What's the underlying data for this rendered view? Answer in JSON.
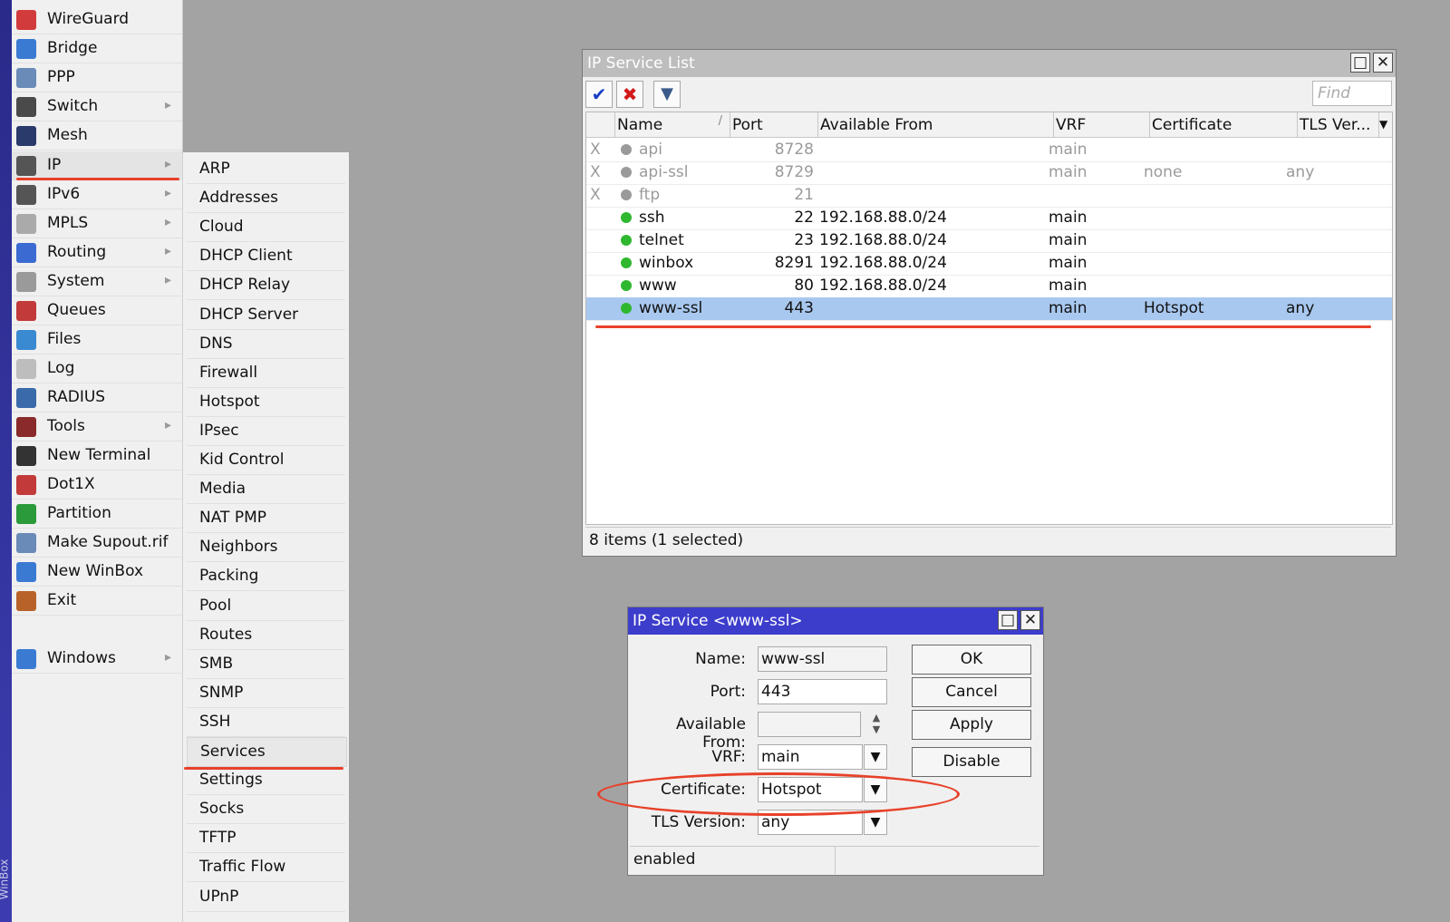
{
  "app": {
    "side_label": "WinBox"
  },
  "main_menu": [
    {
      "label": "WireGuard",
      "icon": "wireguard-icon",
      "color": "#d23b3b",
      "arrow": false
    },
    {
      "label": "Bridge",
      "icon": "bridge-icon",
      "color": "#3b7ad2",
      "arrow": false
    },
    {
      "label": "PPP",
      "icon": "ppp-icon",
      "color": "#6a8ab8",
      "arrow": false
    },
    {
      "label": "Switch",
      "icon": "switch-icon",
      "color": "#4a4a4a",
      "arrow": true
    },
    {
      "label": "Mesh",
      "icon": "mesh-icon",
      "color": "#2a3a6a",
      "arrow": false
    },
    {
      "label": "IP",
      "icon": "ip-icon",
      "color": "#555555",
      "arrow": true
    },
    {
      "label": "IPv6",
      "icon": "ipv6-icon",
      "color": "#555555",
      "arrow": true
    },
    {
      "label": "MPLS",
      "icon": "mpls-icon",
      "color": "#aaaaaa",
      "arrow": true
    },
    {
      "label": "Routing",
      "icon": "routing-icon",
      "color": "#3b6ad2",
      "arrow": true
    },
    {
      "label": "System",
      "icon": "system-icon",
      "color": "#9a9a9a",
      "arrow": true
    },
    {
      "label": "Queues",
      "icon": "queues-icon",
      "color": "#c23a3a",
      "arrow": false
    },
    {
      "label": "Files",
      "icon": "files-icon",
      "color": "#3a8ad2",
      "arrow": false
    },
    {
      "label": "Log",
      "icon": "log-icon",
      "color": "#bdbdbd",
      "arrow": false
    },
    {
      "label": "RADIUS",
      "icon": "radius-icon",
      "color": "#3a6aaa",
      "arrow": false
    },
    {
      "label": "Tools",
      "icon": "tools-icon",
      "color": "#8a2a2a",
      "arrow": true
    },
    {
      "label": "New Terminal",
      "icon": "terminal-icon",
      "color": "#333333",
      "arrow": false
    },
    {
      "label": "Dot1X",
      "icon": "dot1x-icon",
      "color": "#c23a3a",
      "arrow": false
    },
    {
      "label": "Partition",
      "icon": "partition-icon",
      "color": "#2a9a3a",
      "arrow": false
    },
    {
      "label": "Make Supout.rif",
      "icon": "supout-icon",
      "color": "#6a8ab8",
      "arrow": false
    },
    {
      "label": "New WinBox",
      "icon": "winbox-icon",
      "color": "#3a7ad2",
      "arrow": false
    },
    {
      "label": "Exit",
      "icon": "exit-icon",
      "color": "#b8622a",
      "arrow": false
    },
    {
      "label": "Windows",
      "icon": "windows-icon",
      "color": "#3a7ad2",
      "arrow": true
    }
  ],
  "ip_submenu": [
    "ARP",
    "Addresses",
    "Cloud",
    "DHCP Client",
    "DHCP Relay",
    "DHCP Server",
    "DNS",
    "Firewall",
    "Hotspot",
    "IPsec",
    "Kid Control",
    "Media",
    "NAT PMP",
    "Neighbors",
    "Packing",
    "Pool",
    "Routes",
    "SMB",
    "SNMP",
    "SSH",
    "Services",
    "Settings",
    "Socks",
    "TFTP",
    "Traffic Flow",
    "UPnP"
  ],
  "service_list": {
    "title": "IP Service List",
    "find_placeholder": "Find",
    "columns": [
      "Name",
      "Port",
      "Available From",
      "VRF",
      "Certificate",
      "TLS Ver..."
    ],
    "rows": [
      {
        "flag": "X",
        "name": "api",
        "port": "8728",
        "available_from": "",
        "vrf": "main",
        "certificate": "",
        "tls": "",
        "enabled": false,
        "selected": false
      },
      {
        "flag": "X",
        "name": "api-ssl",
        "port": "8729",
        "available_from": "",
        "vrf": "main",
        "certificate": "none",
        "tls": "any",
        "enabled": false,
        "selected": false
      },
      {
        "flag": "X",
        "name": "ftp",
        "port": "21",
        "available_from": "",
        "vrf": "",
        "certificate": "",
        "tls": "",
        "enabled": false,
        "selected": false
      },
      {
        "flag": "",
        "name": "ssh",
        "port": "22",
        "available_from": "192.168.88.0/24",
        "vrf": "main",
        "certificate": "",
        "tls": "",
        "enabled": true,
        "selected": false
      },
      {
        "flag": "",
        "name": "telnet",
        "port": "23",
        "available_from": "192.168.88.0/24",
        "vrf": "main",
        "certificate": "",
        "tls": "",
        "enabled": true,
        "selected": false
      },
      {
        "flag": "",
        "name": "winbox",
        "port": "8291",
        "available_from": "192.168.88.0/24",
        "vrf": "main",
        "certificate": "",
        "tls": "",
        "enabled": true,
        "selected": false
      },
      {
        "flag": "",
        "name": "www",
        "port": "80",
        "available_from": "192.168.88.0/24",
        "vrf": "main",
        "certificate": "",
        "tls": "",
        "enabled": true,
        "selected": false
      },
      {
        "flag": "",
        "name": "www-ssl",
        "port": "443",
        "available_from": "",
        "vrf": "main",
        "certificate": "Hotspot",
        "tls": "any",
        "enabled": true,
        "selected": true
      }
    ],
    "status": "8 items (1 selected)"
  },
  "dialog": {
    "title": "IP Service <www-ssl>",
    "name_label": "Name:",
    "name_value": "www-ssl",
    "port_label": "Port:",
    "port_value": "443",
    "available_label": "Available From:",
    "available_value": "",
    "vrf_label": "VRF:",
    "vrf_value": "main",
    "cert_label": "Certificate:",
    "cert_value": "Hotspot",
    "tls_label": "TLS Version:",
    "tls_value": "any",
    "ok": "OK",
    "cancel": "Cancel",
    "apply": "Apply",
    "disable": "Disable",
    "status": "enabled"
  },
  "colors": {
    "enabled_dot": "#2fb82f",
    "disabled_dot": "#9a9a9a",
    "highlight": "#e8412a",
    "selected_row": "#a9c8ef"
  }
}
